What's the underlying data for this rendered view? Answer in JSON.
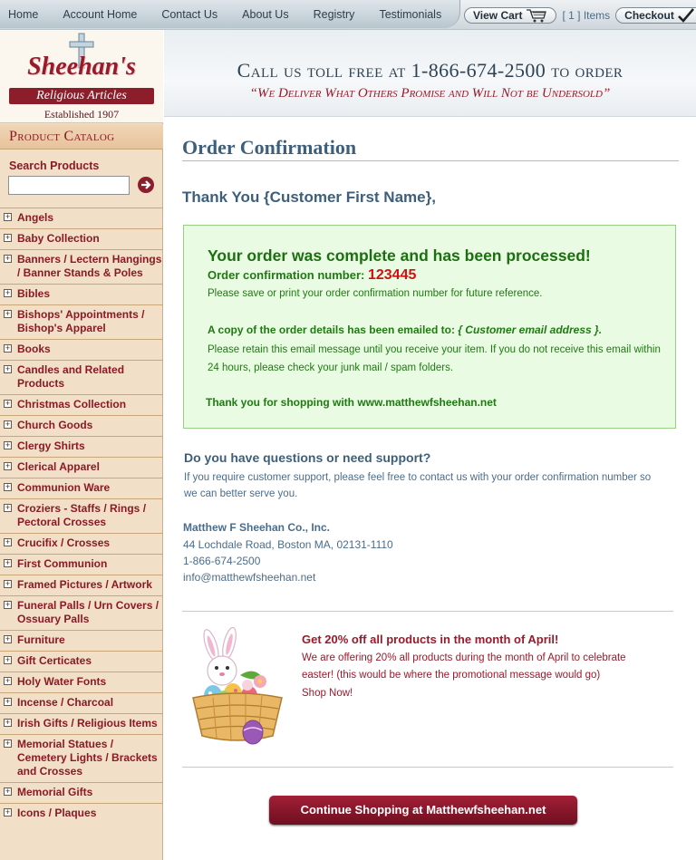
{
  "nav": {
    "links": [
      "Home",
      "Account Home",
      "Contact Us",
      "About Us",
      "Registry",
      "Testimonials"
    ],
    "view_cart": "View Cart",
    "items": "[ 1 ] Items",
    "checkout": "Checkout"
  },
  "logo": {
    "name": "Sheehan's",
    "subtitle": "Religious Articles",
    "established": "Established 1907"
  },
  "sidebar": {
    "catalog_heading": "Product Catalog",
    "search_label": "Search Products",
    "search_value": "",
    "categories": [
      "Angels",
      "Baby Collection",
      "Banners / Lectern Hangings / Banner Stands & Poles",
      "Bibles",
      "Bishops' Appointments / Bishop's Apparel",
      "Books",
      "Candles and Related Products",
      "Christmas Collection",
      "Church Goods",
      "Clergy Shirts",
      "Clerical Apparel",
      "Communion Ware",
      "Croziers - Staffs / Rings / Pectoral Crosses",
      "Crucifix / Crosses",
      "First Communion",
      "Framed Pictures / Artwork",
      "Funeral Palls / Urn Covers / Ossuary Palls",
      "Furniture",
      "Gift Certicates",
      "Holy Water Fonts",
      "Incense / Charcoal",
      "Irish Gifts / Religious Items",
      "Memorial Statues / Cemetery Lights / Brackets and Crosses",
      "Memorial Gifts",
      "Icons / Plaques"
    ]
  },
  "banner": {
    "title": "Call us toll free at 1-866-674-2500 to order",
    "subtitle": "“We Deliver What Others Promise and Will Not be Undersold”"
  },
  "main": {
    "page_title": "Order Confirmation",
    "thank_you": "Thank You {Customer First Name},",
    "confirm": {
      "heading": "Your order was complete and has been processed!",
      "number_label": "Order confirmation number:",
      "number": "123445",
      "save_note": "Please save or print your order confirmation number for future reference.",
      "copy_label": "A copy of the order details has been emailed to:",
      "email": "{ Customer email address }.",
      "retain_note": "Please retain this email message until you receive your item.  If you do not receive this email within 24 hours, please check your junk mail / spam folders.",
      "thanks": "Thank you for shopping with www.matthewfsheehan.net"
    },
    "support": {
      "heading": "Do you have questions or need support?",
      "text": "If you require customer support, please feel free to contact us with your order confirmation number so we can better serve you."
    },
    "company": {
      "name": "Matthew F Sheehan Co., Inc.",
      "address": "44 Lochdale Road, Boston MA, 02131-1110",
      "phone": "1-866-674-2500",
      "email": "info@matthewfsheehan.net"
    },
    "promo": {
      "heading": "Get 20% off all products in the month of April!",
      "text": "We are offering 20% all products during the month of April to celebrate easter!  (this would be where the promotional message would go)",
      "link": "Shop Now!"
    },
    "continue_button": "Continue Shopping at Matthewfsheehan.net"
  }
}
